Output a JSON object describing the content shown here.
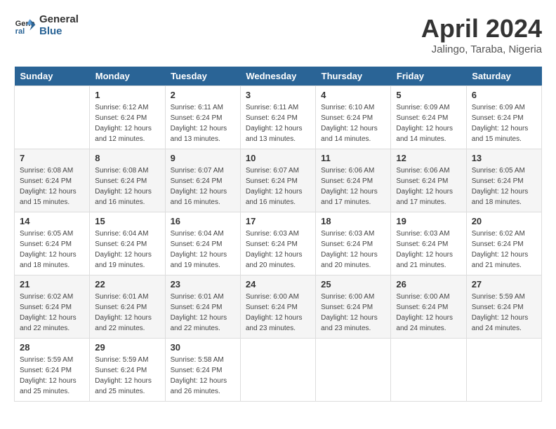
{
  "header": {
    "logo_line1": "General",
    "logo_line2": "Blue",
    "month": "April 2024",
    "location": "Jalingo, Taraba, Nigeria"
  },
  "days_of_week": [
    "Sunday",
    "Monday",
    "Tuesday",
    "Wednesday",
    "Thursday",
    "Friday",
    "Saturday"
  ],
  "weeks": [
    [
      {
        "num": "",
        "sunrise": "",
        "sunset": "",
        "daylight": ""
      },
      {
        "num": "1",
        "sunrise": "Sunrise: 6:12 AM",
        "sunset": "Sunset: 6:24 PM",
        "daylight": "Daylight: 12 hours and 12 minutes."
      },
      {
        "num": "2",
        "sunrise": "Sunrise: 6:11 AM",
        "sunset": "Sunset: 6:24 PM",
        "daylight": "Daylight: 12 hours and 13 minutes."
      },
      {
        "num": "3",
        "sunrise": "Sunrise: 6:11 AM",
        "sunset": "Sunset: 6:24 PM",
        "daylight": "Daylight: 12 hours and 13 minutes."
      },
      {
        "num": "4",
        "sunrise": "Sunrise: 6:10 AM",
        "sunset": "Sunset: 6:24 PM",
        "daylight": "Daylight: 12 hours and 14 minutes."
      },
      {
        "num": "5",
        "sunrise": "Sunrise: 6:09 AM",
        "sunset": "Sunset: 6:24 PM",
        "daylight": "Daylight: 12 hours and 14 minutes."
      },
      {
        "num": "6",
        "sunrise": "Sunrise: 6:09 AM",
        "sunset": "Sunset: 6:24 PM",
        "daylight": "Daylight: 12 hours and 15 minutes."
      }
    ],
    [
      {
        "num": "7",
        "sunrise": "Sunrise: 6:08 AM",
        "sunset": "Sunset: 6:24 PM",
        "daylight": "Daylight: 12 hours and 15 minutes."
      },
      {
        "num": "8",
        "sunrise": "Sunrise: 6:08 AM",
        "sunset": "Sunset: 6:24 PM",
        "daylight": "Daylight: 12 hours and 16 minutes."
      },
      {
        "num": "9",
        "sunrise": "Sunrise: 6:07 AM",
        "sunset": "Sunset: 6:24 PM",
        "daylight": "Daylight: 12 hours and 16 minutes."
      },
      {
        "num": "10",
        "sunrise": "Sunrise: 6:07 AM",
        "sunset": "Sunset: 6:24 PM",
        "daylight": "Daylight: 12 hours and 16 minutes."
      },
      {
        "num": "11",
        "sunrise": "Sunrise: 6:06 AM",
        "sunset": "Sunset: 6:24 PM",
        "daylight": "Daylight: 12 hours and 17 minutes."
      },
      {
        "num": "12",
        "sunrise": "Sunrise: 6:06 AM",
        "sunset": "Sunset: 6:24 PM",
        "daylight": "Daylight: 12 hours and 17 minutes."
      },
      {
        "num": "13",
        "sunrise": "Sunrise: 6:05 AM",
        "sunset": "Sunset: 6:24 PM",
        "daylight": "Daylight: 12 hours and 18 minutes."
      }
    ],
    [
      {
        "num": "14",
        "sunrise": "Sunrise: 6:05 AM",
        "sunset": "Sunset: 6:24 PM",
        "daylight": "Daylight: 12 hours and 18 minutes."
      },
      {
        "num": "15",
        "sunrise": "Sunrise: 6:04 AM",
        "sunset": "Sunset: 6:24 PM",
        "daylight": "Daylight: 12 hours and 19 minutes."
      },
      {
        "num": "16",
        "sunrise": "Sunrise: 6:04 AM",
        "sunset": "Sunset: 6:24 PM",
        "daylight": "Daylight: 12 hours and 19 minutes."
      },
      {
        "num": "17",
        "sunrise": "Sunrise: 6:03 AM",
        "sunset": "Sunset: 6:24 PM",
        "daylight": "Daylight: 12 hours and 20 minutes."
      },
      {
        "num": "18",
        "sunrise": "Sunrise: 6:03 AM",
        "sunset": "Sunset: 6:24 PM",
        "daylight": "Daylight: 12 hours and 20 minutes."
      },
      {
        "num": "19",
        "sunrise": "Sunrise: 6:03 AM",
        "sunset": "Sunset: 6:24 PM",
        "daylight": "Daylight: 12 hours and 21 minutes."
      },
      {
        "num": "20",
        "sunrise": "Sunrise: 6:02 AM",
        "sunset": "Sunset: 6:24 PM",
        "daylight": "Daylight: 12 hours and 21 minutes."
      }
    ],
    [
      {
        "num": "21",
        "sunrise": "Sunrise: 6:02 AM",
        "sunset": "Sunset: 6:24 PM",
        "daylight": "Daylight: 12 hours and 22 minutes."
      },
      {
        "num": "22",
        "sunrise": "Sunrise: 6:01 AM",
        "sunset": "Sunset: 6:24 PM",
        "daylight": "Daylight: 12 hours and 22 minutes."
      },
      {
        "num": "23",
        "sunrise": "Sunrise: 6:01 AM",
        "sunset": "Sunset: 6:24 PM",
        "daylight": "Daylight: 12 hours and 22 minutes."
      },
      {
        "num": "24",
        "sunrise": "Sunrise: 6:00 AM",
        "sunset": "Sunset: 6:24 PM",
        "daylight": "Daylight: 12 hours and 23 minutes."
      },
      {
        "num": "25",
        "sunrise": "Sunrise: 6:00 AM",
        "sunset": "Sunset: 6:24 PM",
        "daylight": "Daylight: 12 hours and 23 minutes."
      },
      {
        "num": "26",
        "sunrise": "Sunrise: 6:00 AM",
        "sunset": "Sunset: 6:24 PM",
        "daylight": "Daylight: 12 hours and 24 minutes."
      },
      {
        "num": "27",
        "sunrise": "Sunrise: 5:59 AM",
        "sunset": "Sunset: 6:24 PM",
        "daylight": "Daylight: 12 hours and 24 minutes."
      }
    ],
    [
      {
        "num": "28",
        "sunrise": "Sunrise: 5:59 AM",
        "sunset": "Sunset: 6:24 PM",
        "daylight": "Daylight: 12 hours and 25 minutes."
      },
      {
        "num": "29",
        "sunrise": "Sunrise: 5:59 AM",
        "sunset": "Sunset: 6:24 PM",
        "daylight": "Daylight: 12 hours and 25 minutes."
      },
      {
        "num": "30",
        "sunrise": "Sunrise: 5:58 AM",
        "sunset": "Sunset: 6:24 PM",
        "daylight": "Daylight: 12 hours and 26 minutes."
      },
      {
        "num": "",
        "sunrise": "",
        "sunset": "",
        "daylight": ""
      },
      {
        "num": "",
        "sunrise": "",
        "sunset": "",
        "daylight": ""
      },
      {
        "num": "",
        "sunrise": "",
        "sunset": "",
        "daylight": ""
      },
      {
        "num": "",
        "sunrise": "",
        "sunset": "",
        "daylight": ""
      }
    ]
  ]
}
